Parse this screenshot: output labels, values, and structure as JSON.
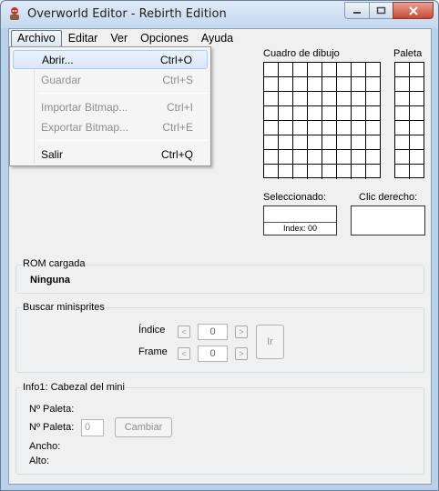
{
  "window": {
    "title": "Overworld Editor - Rebirth Edition",
    "accent": "#b9d1ea"
  },
  "menu": {
    "items": [
      "Archivo",
      "Editar",
      "Ver",
      "Opciones",
      "Ayuda"
    ],
    "active": "Archivo"
  },
  "dropdown": {
    "items": [
      {
        "label": "Abrir...",
        "shortcut": "Ctrl+O",
        "enabled": true,
        "highlighted": true
      },
      {
        "label": "Guardar",
        "shortcut": "Ctrl+S",
        "enabled": false
      },
      {
        "label": "Importar Bitmap...",
        "shortcut": "Ctrl+I",
        "enabled": false
      },
      {
        "label": "Exportar Bitmap...",
        "shortcut": "Ctrl+E",
        "enabled": false
      },
      {
        "label": "Salir",
        "shortcut": "Ctrl+Q",
        "enabled": true
      }
    ]
  },
  "drawing": {
    "label": "Cuadro de dibujo",
    "palette_label": "Paleta",
    "selected_label": "Seleccionado:",
    "right_click_label": "Clic derecho:",
    "index_text": "Index: 00"
  },
  "rom": {
    "group_title": "ROM cargada",
    "value": "Ninguna"
  },
  "search": {
    "group_title": "Buscar minisprites",
    "index_label": "Índice",
    "frame_label": "Frame",
    "index_value": "0",
    "frame_value": "0",
    "go_label": "Ir",
    "prev_glyph": "<",
    "next_glyph": ">"
  },
  "info": {
    "group_title": "Info1: Cabezal del mini",
    "palette_label_1": "Nº Paleta:",
    "palette_label_2": "Nº Paleta:",
    "palette_input": "0",
    "change_label": "Cambiar",
    "width_label": "Ancho:",
    "height_label": "Alto:"
  }
}
